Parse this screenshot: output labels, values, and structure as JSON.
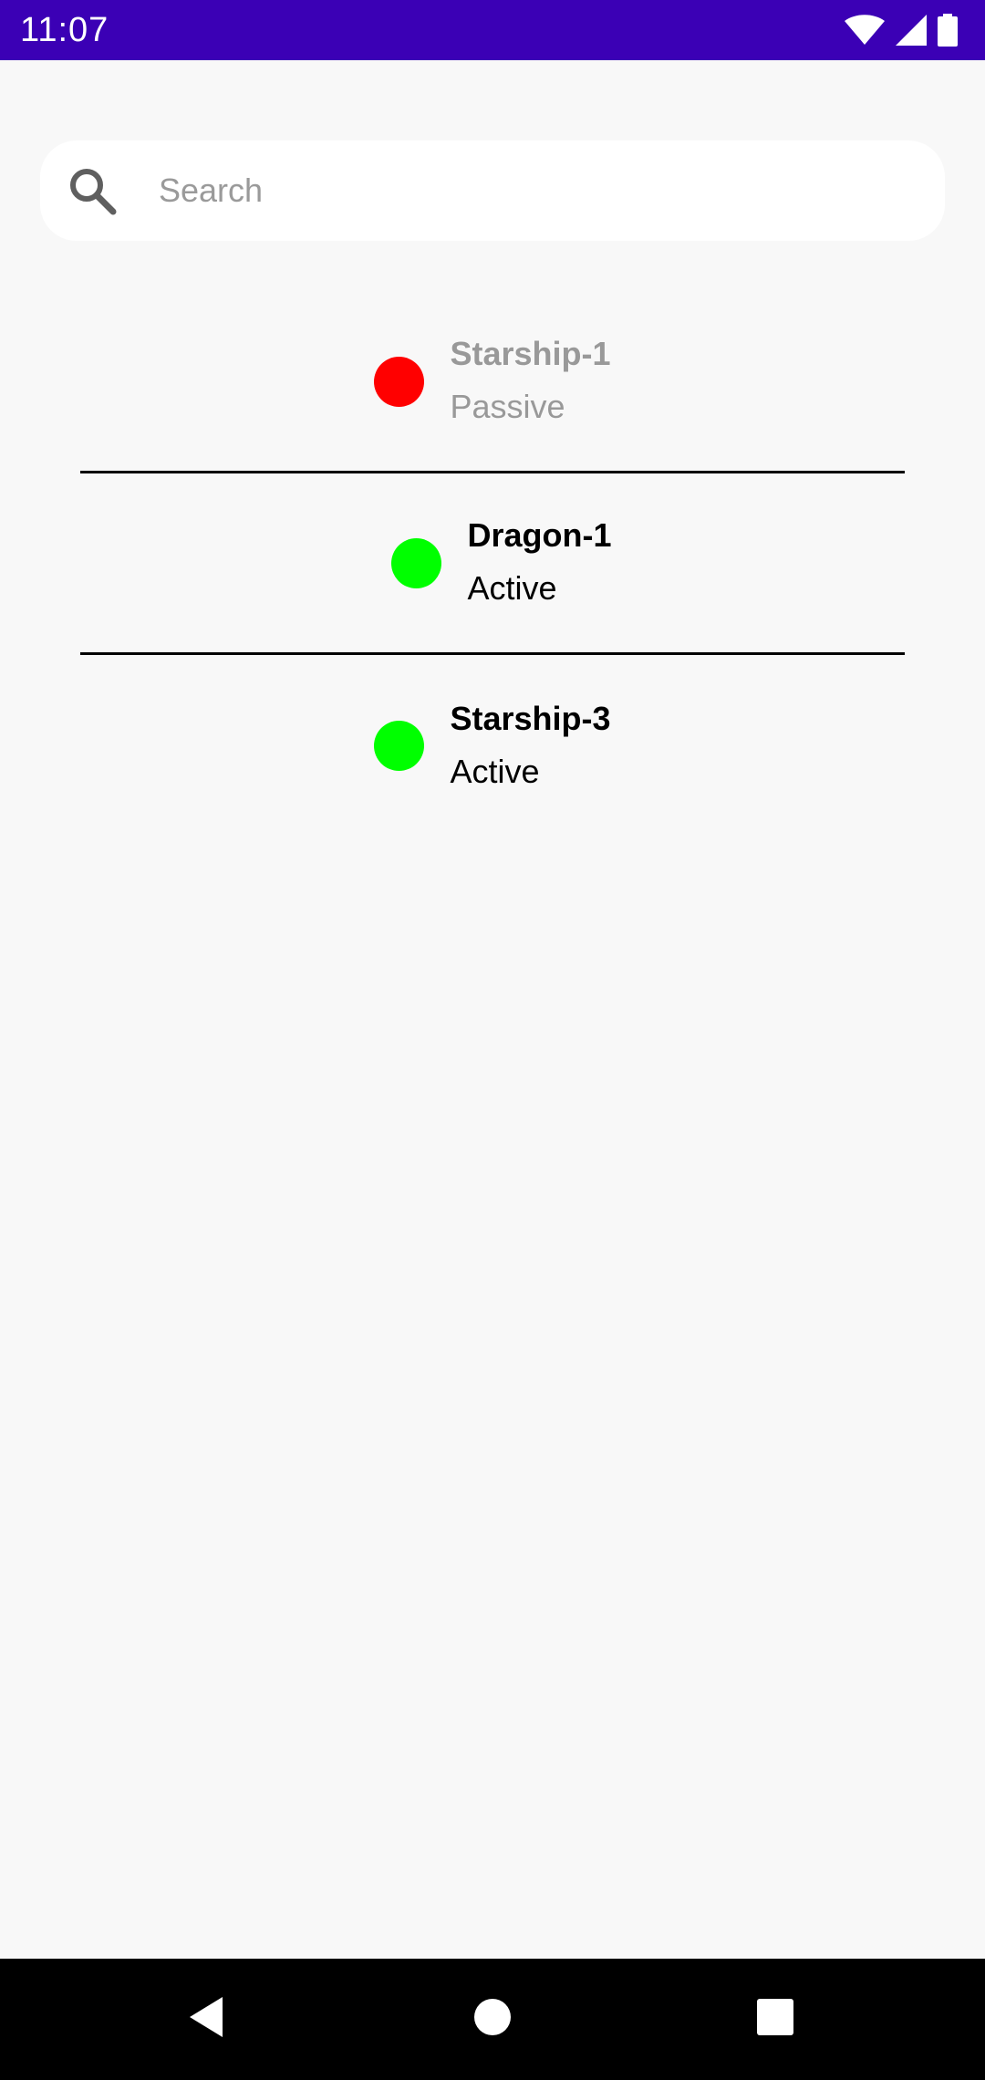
{
  "status_bar": {
    "time": "11:07",
    "icons": [
      "wifi-icon",
      "cellular-signal-icon",
      "battery-icon"
    ],
    "background_color": "#3b00b5"
  },
  "search": {
    "placeholder": "Search",
    "value": "",
    "icon": "search-icon"
  },
  "items": [
    {
      "name": "Starship-1",
      "status": "Passive",
      "dot_color": "#ff0000"
    },
    {
      "name": "Dragon-1",
      "status": "Active",
      "dot_color": "#00ff00"
    },
    {
      "name": "Starship-3",
      "status": "Active",
      "dot_color": "#00ff00"
    }
  ],
  "nav_bar": {
    "buttons": [
      "back-icon",
      "home-icon",
      "recents-icon"
    ]
  }
}
